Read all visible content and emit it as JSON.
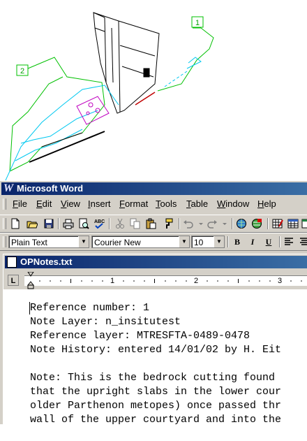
{
  "cad": {
    "label_1": "1",
    "label_2": "2"
  },
  "app": {
    "title": "Microsoft Word",
    "icon_letter": "W"
  },
  "menu": [
    {
      "label": "File"
    },
    {
      "label": "Edit"
    },
    {
      "label": "View"
    },
    {
      "label": "Insert"
    },
    {
      "label": "Format"
    },
    {
      "label": "Tools"
    },
    {
      "label": "Table"
    },
    {
      "label": "Window"
    },
    {
      "label": "Help"
    }
  ],
  "formatting": {
    "style": "Plain Text",
    "font": "Courier New",
    "size": "10",
    "bold_label": "B",
    "italic_label": "I",
    "underline_label": "U"
  },
  "document": {
    "title": "OPNotes.txt",
    "tab_selector": "L",
    "ruler_numbers": [
      "1",
      "2",
      "3"
    ],
    "lines": [
      "Reference number: 1",
      "Note Layer: n_insitutest",
      "Reference layer: MTRESFTA-0489-0478",
      "Note History: entered 14/01/02 by H. Eit",
      "",
      "Note: This is the bedrock cutting found",
      "that the upright slabs in the lower cour",
      "older Parthenon metopes) once passed thr",
      "wall of the upper courtyard and into the",
      "                                         "
    ]
  }
}
